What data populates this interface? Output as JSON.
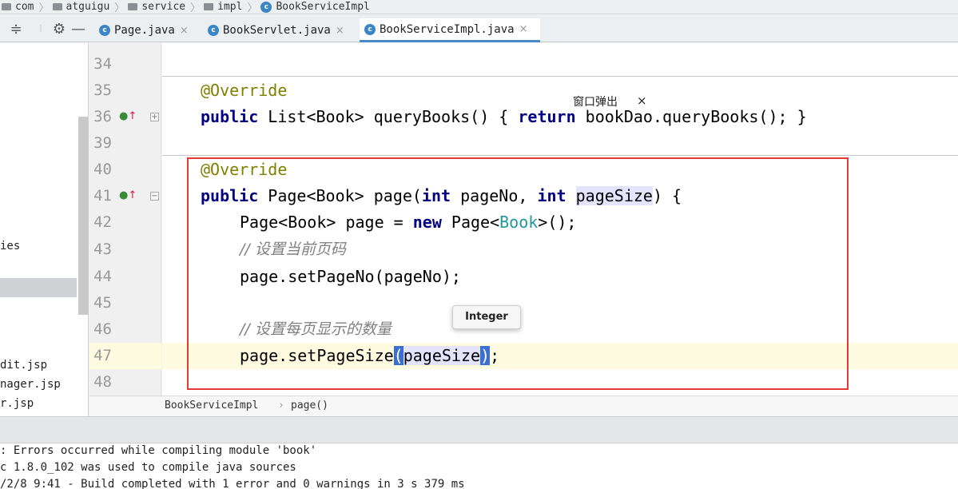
{
  "breadcrumb": [
    "com",
    "atguigu",
    "service",
    "impl",
    "BookServiceImpl"
  ],
  "toolbar": {
    "collapse_icon": "collapse-icon",
    "settings_icon": "gear-icon",
    "hide_icon": "minimize-icon"
  },
  "tabs": [
    {
      "label": "Page.java",
      "active": false
    },
    {
      "label": "BookServlet.java",
      "active": false
    },
    {
      "label": "BookServiceImpl.java",
      "active": true
    }
  ],
  "project_panel": {
    "items": [
      "ies",
      "dit.jsp",
      "nager.jsp",
      "r.jsp"
    ]
  },
  "editor": {
    "line_numbers": [
      "34",
      "35",
      "36",
      "39",
      "40",
      "41",
      "42",
      "43",
      "44",
      "45",
      "46",
      "47",
      "48"
    ],
    "lines": {
      "l35": "@Override",
      "l36a": "public",
      "l36b": " List<Book> queryBooks() ",
      "l36c": "{ ",
      "l36d": "return",
      "l36e": " bookDao.queryBooks(); }",
      "l40": "@Override",
      "l41a": "public",
      "l41b": " Page<Book> page(",
      "l41c": "int",
      "l41d": " pageNo, ",
      "l41e": "int",
      "l41f": " ",
      "l41g": "pageSize",
      "l41h": ") {",
      "l42a": "Page<Book> page = ",
      "l42b": "new",
      "l42c": " Page<",
      "l42d": "Book",
      "l42e": ">();",
      "l43": "// 设置当前页码",
      "l44": "page.setPageNo(pageNo);",
      "l46": "// 设置每页显示的数量",
      "l47a": "page.setPageSize",
      "l47b": "(",
      "l47c": "pageSize",
      "l47d": ")",
      "l47e": ";"
    }
  },
  "popup": {
    "label": "窗口弹出",
    "close": "×"
  },
  "tooltip": "Integer",
  "method_breadcrumb": {
    "class": "BookServiceImpl",
    "method": "page()"
  },
  "output": [
    ": Errors occurred while compiling module 'book'",
    "c 1.8.0_102 was used to compile java sources",
    "/2/8 9:41 - Build completed with 1 error and 0 warnings in 3 s 379 ms"
  ],
  "colors": {
    "accent": "#4a88c7",
    "annotation_box": "#e53935",
    "keyword": "#000080",
    "annotation": "#808000",
    "comment": "#808080"
  }
}
